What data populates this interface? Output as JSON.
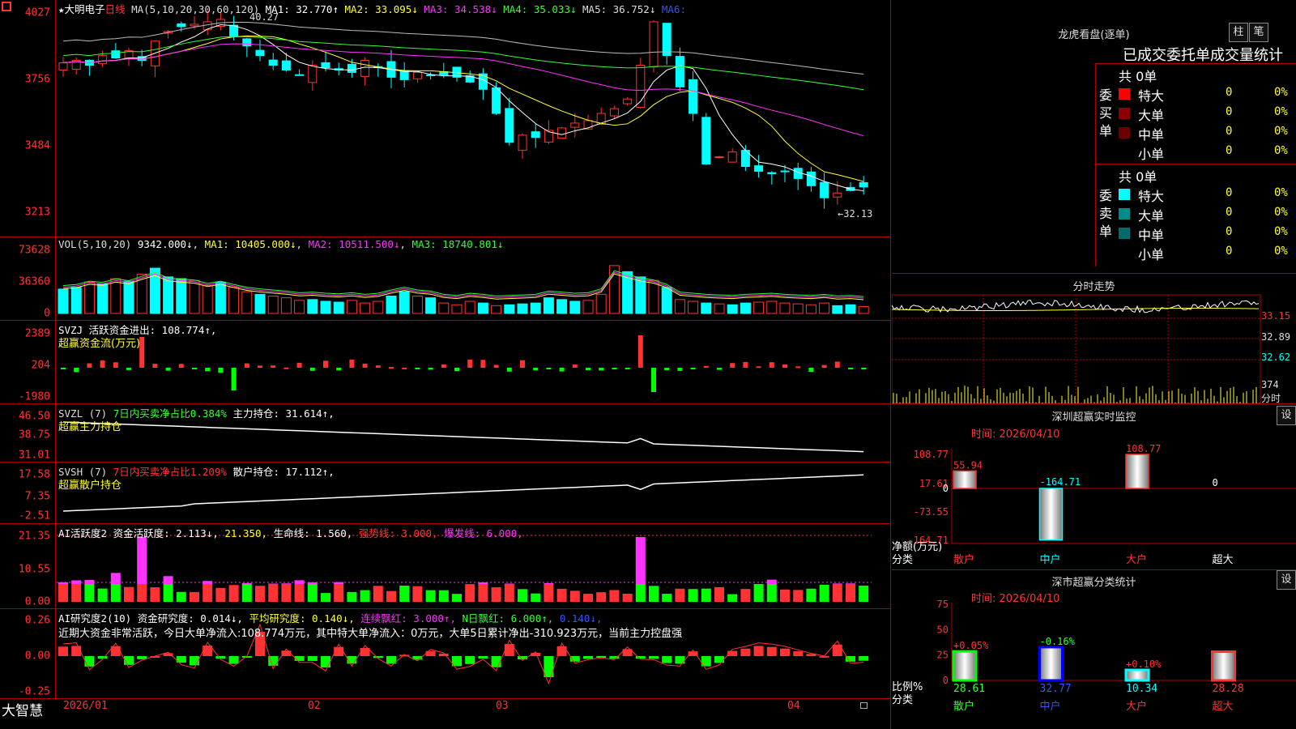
{
  "header": {
    "price_icon": "lock-icon",
    "stock": "★大明电子",
    "period": "日线",
    "ma_label": "MA(5,10,20,30,60,120)",
    "ma1": "MA1: 32.770↑",
    "ma2": "MA2: 33.095↓",
    "ma3": "MA3: 34.538↓",
    "ma4": "MA4: 35.033↓",
    "ma5": "MA5: 36.752↓",
    "ma6": "MA6:",
    "high_mark": "40.27",
    "low_mark": "←32.13"
  },
  "price_axis": [
    "4027",
    "3756",
    "3484",
    "3213"
  ],
  "vol": {
    "header": "VOL(5,10,20)",
    "v": "9342.000↓",
    "ma1": "MA1: 10405.000↓",
    "ma2": "MA2: 10511.500↓",
    "ma3": "MA3: 18740.801↓",
    "axis": [
      "73628",
      "36360",
      "0"
    ]
  },
  "svzj": {
    "header": "SVZJ  活跃资金进出: 108.774↑,",
    "sub": "超赢资金流(万元)",
    "axis": [
      "2389",
      "204",
      "-1980"
    ]
  },
  "svzl": {
    "header_a": "SVZL (7)",
    "header_b": "7日内买卖净占比0.384%",
    "header_c": "主力持仓: 31.614↑,",
    "sub": "超赢主力持仓",
    "axis": [
      "46.50",
      "38.75",
      "31.01"
    ]
  },
  "svsh": {
    "header_a": "SVSH (7)",
    "header_b": "7日内买卖净占比1.209%",
    "header_c": "散户持仓: 17.112↑,",
    "sub": "超赢散户持仓",
    "axis": [
      "17.58",
      "7.35",
      "-2.51"
    ]
  },
  "ai1": {
    "a": "AI活跃度2",
    "b": "资金活跃度: 2.113↓,",
    "c": "21.350,",
    "d": "生命线: 1.560,",
    "e": "强势线: 3.000,",
    "f": "爆发线: 6.000,",
    "axis": [
      "21.35",
      "10.55",
      "0.00"
    ]
  },
  "ai2": {
    "a": "AI研究度2(10)",
    "b": "资金研究度: 0.014↓,",
    "c": "平均研究度: 0.140↓,",
    "d": "连续飘红: 3.000↑,",
    "e": "N日飘红: 6.000↑,",
    "f": "0.140↓,",
    "note": "近期大资金非常活跃，今日大单净流入:108.774万元，其中特大单净流入：0万元，大单5日累计净出-310.923万元，当前主力控盘强",
    "axis": [
      "0.26",
      "0.00",
      "-0.25"
    ]
  },
  "dates": [
    "2026/01",
    "02",
    "03",
    "04"
  ],
  "brand": "大智慧",
  "lhb": {
    "title": "龙虎看盘(逐单)",
    "btn1": "柱",
    "btn2": "笔",
    "subtitle": "已成交委托单成交量统计",
    "buy_label": "委买单",
    "sell_label": "委卖单",
    "buy_total": "共 0单",
    "sell_total": "共 0单",
    "rows": [
      {
        "name": "特大",
        "qty": "0",
        "pct": "0%"
      },
      {
        "name": "大单",
        "qty": "0",
        "pct": "0%"
      },
      {
        "name": "中单",
        "qty": "0",
        "pct": "0%"
      },
      {
        "name": "小单",
        "qty": "0",
        "pct": "0%"
      }
    ],
    "buy_colors": [
      "#ff0000",
      "#8b0000",
      "#6a0000",
      ""
    ],
    "sell_colors": [
      "#00ffff",
      "#008b8b",
      "#006b6b",
      ""
    ]
  },
  "fenshi": {
    "title": "分时走势",
    "axis": [
      "33.15",
      "32.89",
      "32.62",
      "374",
      "分时"
    ]
  },
  "monitor": {
    "title": "深圳超赢实时监控",
    "btn": "设",
    "time": "时间: 2026/04/10",
    "axis": [
      "108.77",
      "17.61",
      "0",
      "-73.55",
      "-164.71"
    ],
    "ylabel": "净额(万元)",
    "xlabel": "分类",
    "cats": [
      "散户",
      "中户",
      "大户",
      "超大"
    ],
    "values": [
      "55.94",
      "-164.71",
      "108.77",
      "0"
    ]
  },
  "classify": {
    "title": "深市超赢分类统计",
    "btn": "设",
    "time": "时间: 2026/04/10",
    "axis": [
      "75",
      "50",
      "25",
      "0"
    ],
    "ylabel": "比例%",
    "xlabel": "分类",
    "cats": [
      "散户",
      "中户",
      "大户",
      "超大"
    ],
    "values": [
      "28.61",
      "32.77",
      "10.34",
      "28.28"
    ],
    "changes": [
      "+0.05%",
      "-0.16%",
      "+0.10%",
      ""
    ]
  }
}
